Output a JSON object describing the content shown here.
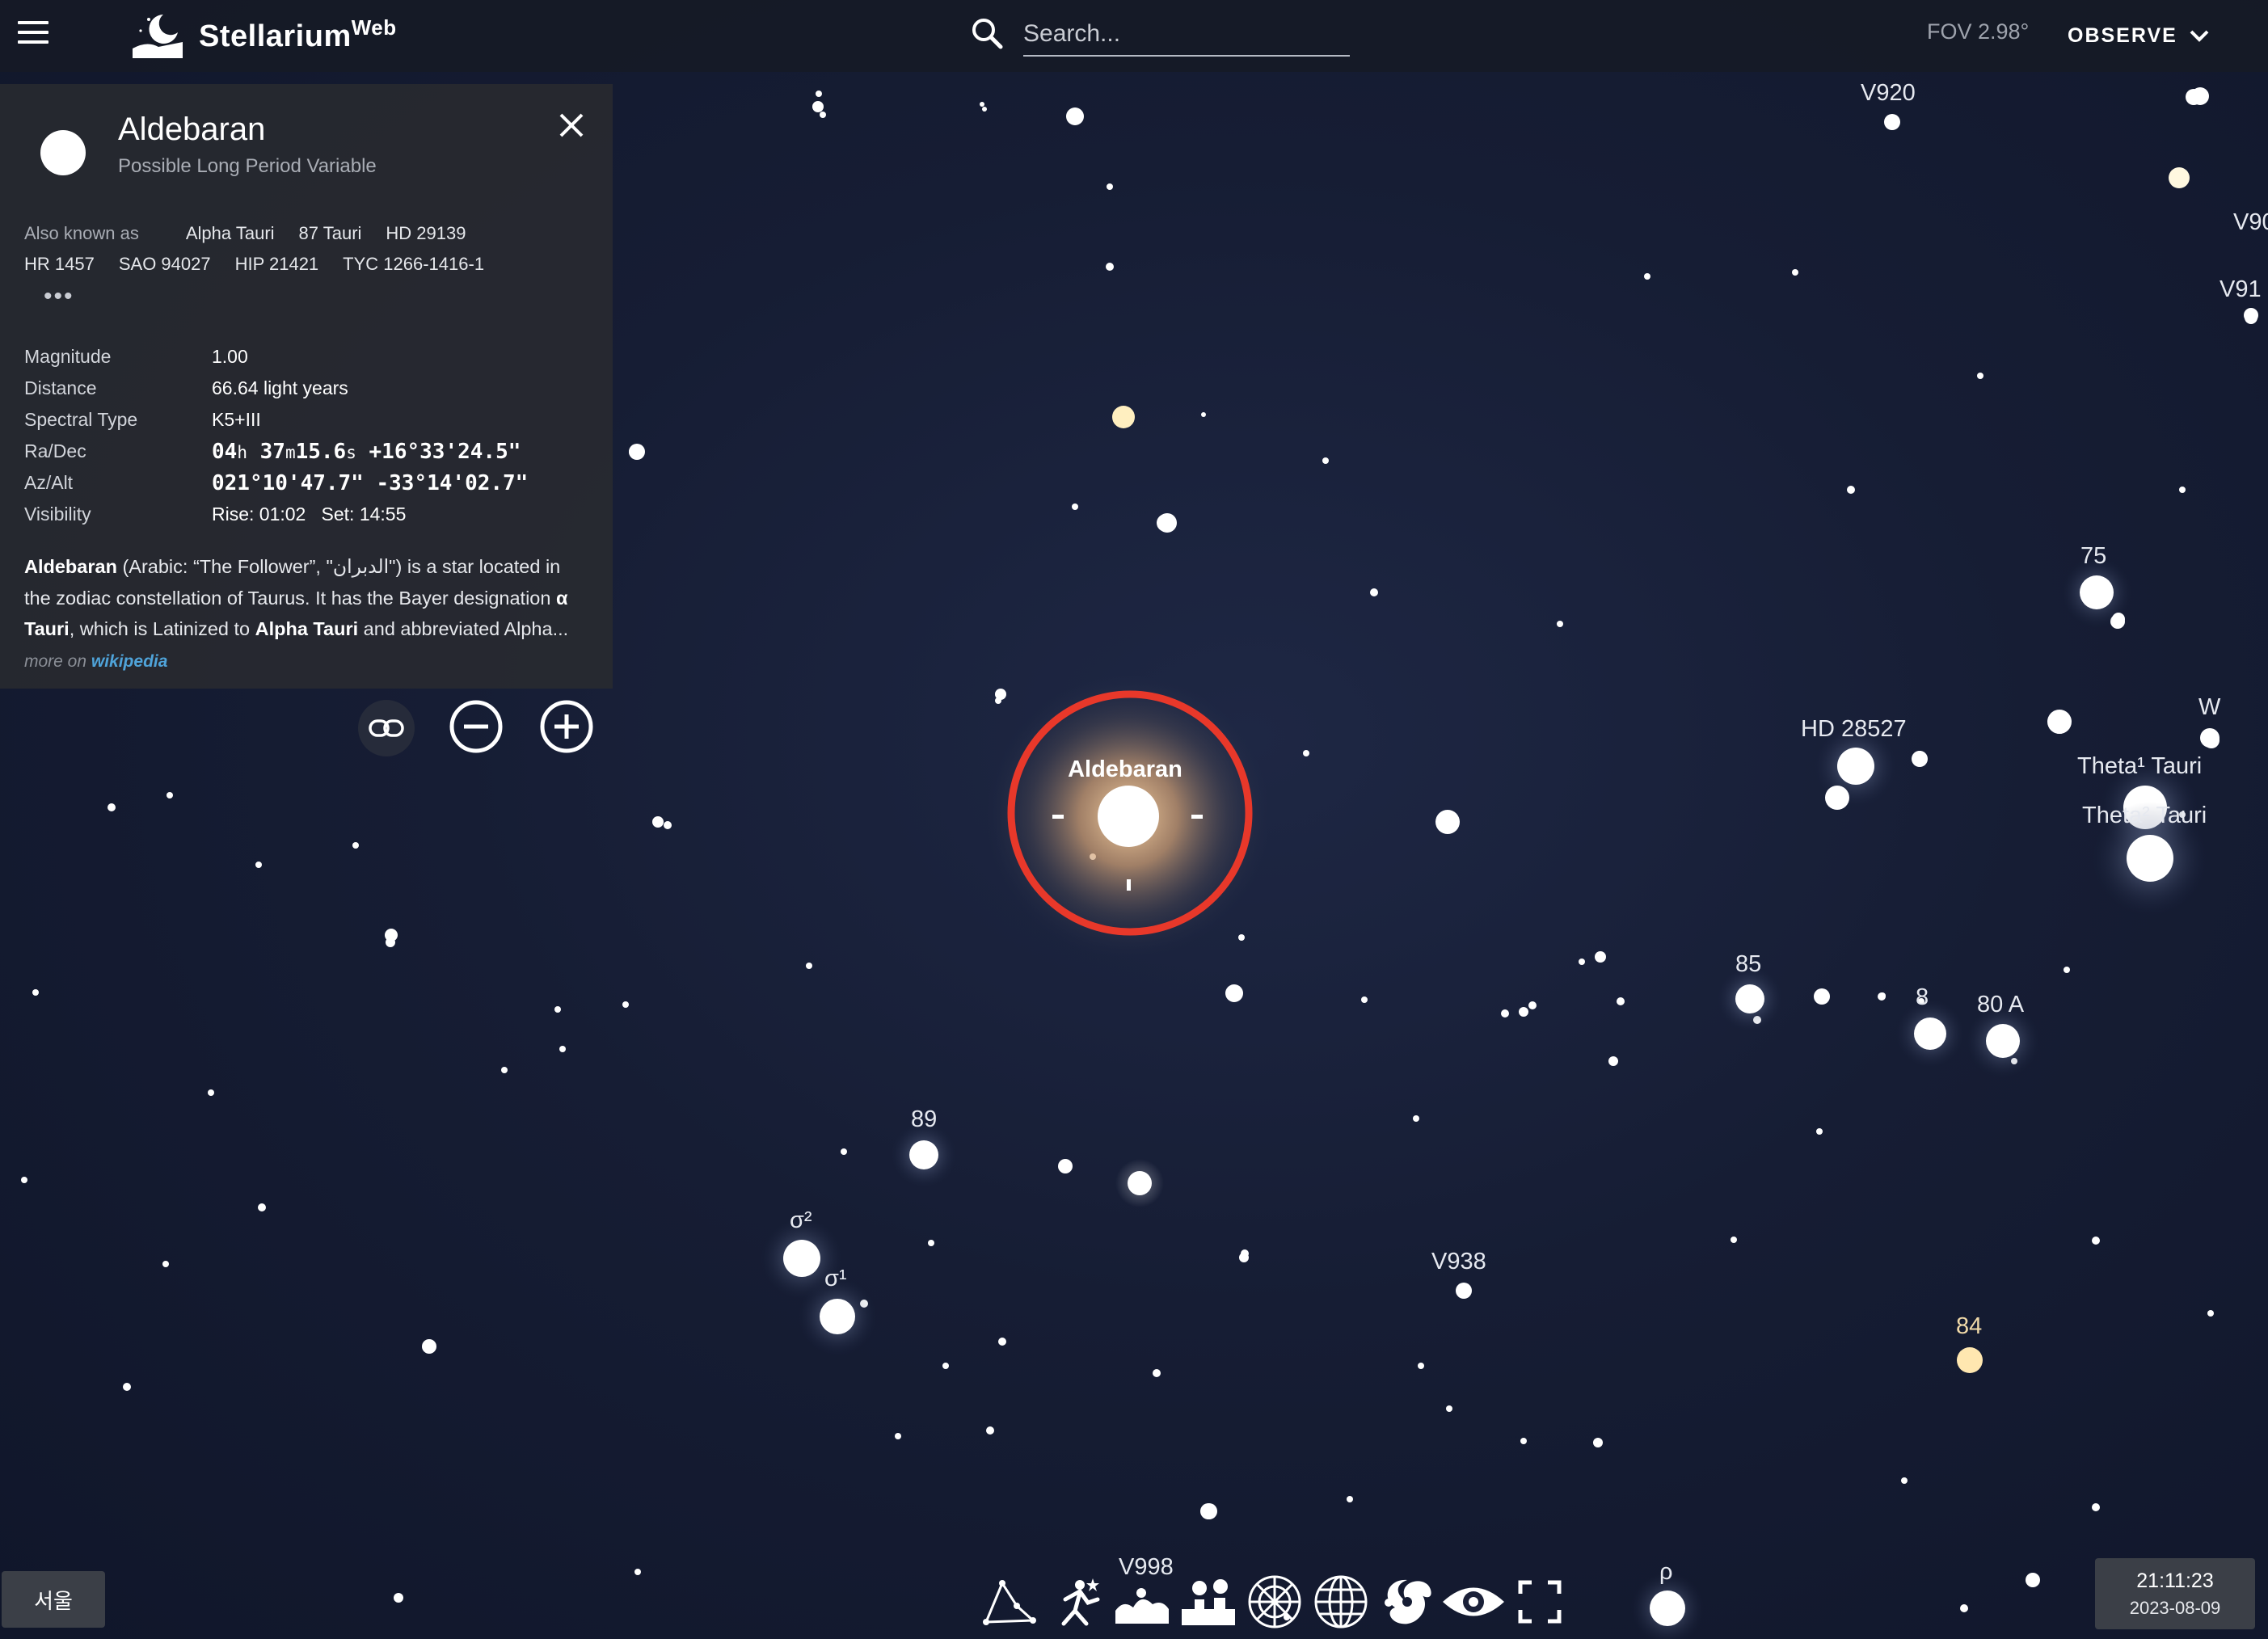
{
  "app": {
    "logo_text": "Stellarium",
    "logo_sup": "Web"
  },
  "search": {
    "placeholder": "Search..."
  },
  "header": {
    "fov": "FOV 2.98°",
    "observe_label": "OBSERVE"
  },
  "selected": {
    "name": "Aldebaran",
    "type": "Possible Long Period Variable",
    "aka_label": "Also known as",
    "aka": [
      "Alpha Tauri",
      "87 Tauri",
      "HD 29139",
      "HR 1457",
      "SAO 94027",
      "HIP 21421",
      "TYC 1266-1416-1"
    ],
    "more_dots": "•••",
    "props": {
      "magnitude": {
        "label": "Magnitude",
        "value": "1.00"
      },
      "distance": {
        "label": "Distance",
        "value": "66.64",
        "unit": "light years"
      },
      "spectral": {
        "label": "Spectral Type",
        "value": "K5+III"
      },
      "radec": {
        "label": "Ra/Dec",
        "ra_h": "04",
        "ra_h_u": "h",
        "ra_m": "37",
        "ra_m_u": "m",
        "ra_s": "15.6",
        "ra_s_u": "s",
        "dec": "+16°33'24.5\""
      },
      "azalt": {
        "label": "Az/Alt",
        "az": "021°10'47.7\"",
        "alt": "-33°14'02.7\""
      },
      "visibility": {
        "label": "Visibility",
        "value": "Rise: 01:02   Set: 14:55"
      }
    },
    "description": {
      "p1_bold": "Aldebaran",
      "p2": " (Arabic: “The Follower”, \"الدبران\") is a star located in the zodiac constellation of Taurus. It has the Bayer designation ",
      "p3_bold": "α Tauri",
      "p4": ", which is Latinized to ",
      "p5_bold": "Alpha Tauri",
      "p6": " and abbreviated Alpha... ",
      "more_on": "more on ",
      "wiki": "wikipedia"
    },
    "sky_label": "Aldebaran"
  },
  "sky_labels": [
    {
      "id": "v920",
      "text": "V920"
    },
    {
      "id": "v90",
      "text": "V90"
    },
    {
      "id": "v91",
      "text": "V91"
    },
    {
      "id": "s75",
      "text": "75"
    },
    {
      "id": "w",
      "text": "W"
    },
    {
      "id": "hd28527",
      "text": "HD 28527"
    },
    {
      "id": "theta1",
      "text": "Theta¹ Tauri"
    },
    {
      "id": "theta2",
      "text": "Theta² Tauri"
    },
    {
      "id": "s85",
      "text": "85"
    },
    {
      "id": "s8",
      "text": "8"
    },
    {
      "id": "s80a",
      "text": "80 A"
    },
    {
      "id": "s89",
      "text": "89"
    },
    {
      "id": "sigma2",
      "text": "σ²"
    },
    {
      "id": "sigma1",
      "text": "σ¹"
    },
    {
      "id": "v938",
      "text": "V938"
    },
    {
      "id": "s84",
      "text": "84"
    },
    {
      "id": "v998",
      "text": "V998"
    },
    {
      "id": "rho",
      "text": "ρ"
    }
  ],
  "bottom": {
    "location": "서울",
    "time": "21:11:23",
    "date": "2023-08-09",
    "toolbar": [
      "constellation-lines",
      "constellation-art",
      "landscape",
      "atmosphere",
      "azimuthal-grid",
      "equatorial-grid",
      "deep-sky-objects",
      "night-mode",
      "fullscreen"
    ]
  },
  "colors": {
    "selection_ring": "#e8382a",
    "topbar": "#161a26",
    "panel": "#282a30",
    "link": "#4fa3d9"
  }
}
